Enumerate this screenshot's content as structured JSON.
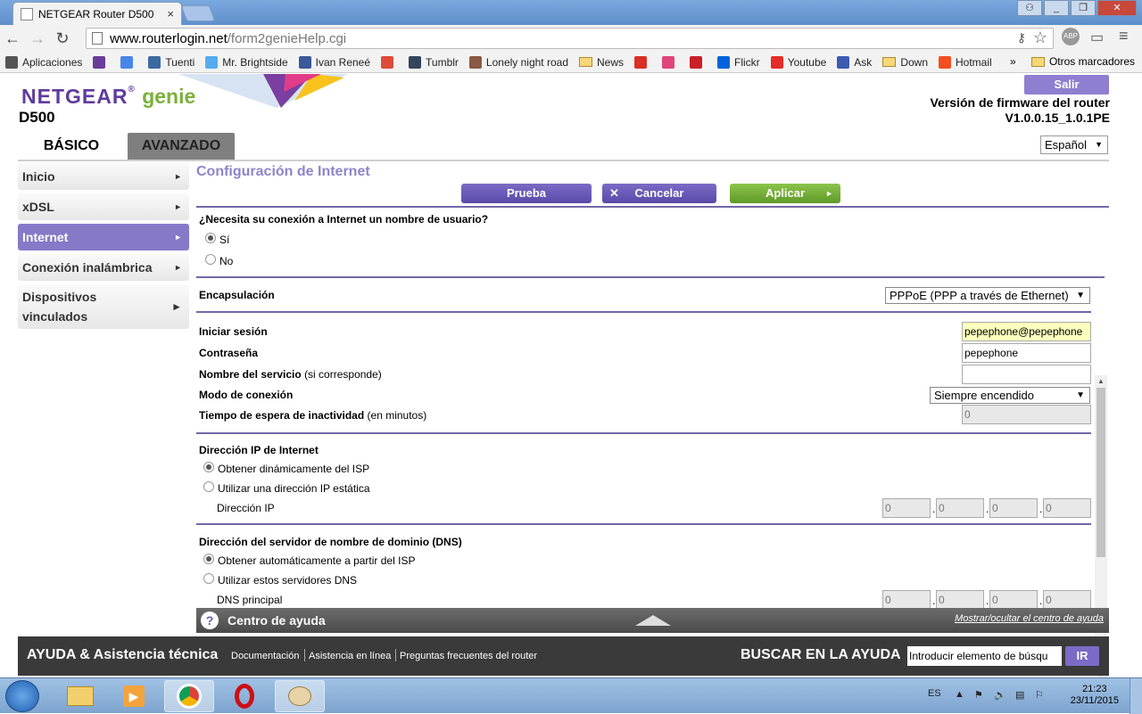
{
  "browser": {
    "tab_title": "NETGEAR Router D500",
    "tab_close": "×",
    "url_domain": "www.routerlogin.net",
    "url_path": "/form2genieHelp.cgi",
    "ext_label": "ABP",
    "bookmarks": [
      {
        "label": "Aplicaciones",
        "icon": "apps-grid-icon",
        "color": "#555555"
      },
      {
        "label": "",
        "icon": "grid-app-icon",
        "color": "#6a3d9a"
      },
      {
        "label": "",
        "icon": "google-icon",
        "color": "#4a86e8"
      },
      {
        "label": "Tuenti",
        "icon": "tuenti-icon",
        "color": "#3b6aa0"
      },
      {
        "label": "Mr. Brightside",
        "icon": "twitter-icon",
        "color": "#55acee"
      },
      {
        "label": "Ivan Reneé",
        "icon": "facebook-icon",
        "color": "#3b5998"
      },
      {
        "label": "",
        "icon": "gplus-icon",
        "color": "#dd4b39"
      },
      {
        "label": "Tumblr",
        "icon": "tumblr-icon",
        "color": "#35465c"
      },
      {
        "label": "Lonely night road",
        "icon": "image-icon",
        "color": "#8a5a44"
      },
      {
        "label": "News",
        "icon": "folder-icon",
        "color": "#f5d77a"
      },
      {
        "label": "",
        "icon": "upload-icon",
        "color": "#d93025"
      },
      {
        "label": "",
        "icon": "heart-icon",
        "color": "#e0457b"
      },
      {
        "label": "",
        "icon": "pinterest-icon",
        "color": "#cb2027"
      },
      {
        "label": "Flickr",
        "icon": "flickr-icon",
        "color": "#0063dc"
      },
      {
        "label": "Youtube",
        "icon": "youtube-icon",
        "color": "#e52d27"
      },
      {
        "label": "Ask",
        "icon": "ask-icon",
        "color": "#3b5bb0"
      },
      {
        "label": "Down",
        "icon": "folder-icon",
        "color": "#f5d77a"
      },
      {
        "label": "Hotmail",
        "icon": "hotmail-icon",
        "color": "#f25022"
      }
    ],
    "bm_more": "»",
    "bm_other": "Otros marcadores"
  },
  "header": {
    "brand_netgear": "NETGEAR",
    "brand_genie": "genie",
    "model": "D500",
    "logout": "Salir",
    "fw_label": "Versión de firmware del router",
    "fw_value": "V1.0.0.15_1.0.1PE",
    "language": "Español",
    "tab_basic": "BÁSICO",
    "tab_advanced": "AVANZADO"
  },
  "nav": {
    "items": [
      {
        "label": "Inicio"
      },
      {
        "label": "xDSL"
      },
      {
        "label": "Internet"
      },
      {
        "label": "Conexión inalámbrica"
      },
      {
        "label": "Dispositivos vinculados"
      }
    ],
    "arrow": "►"
  },
  "form": {
    "title": "Configuración de Internet",
    "btn_test": "Prueba",
    "btn_cancel": "Cancelar",
    "btn_cancel_icon": "✕",
    "btn_apply": "Aplicar",
    "q_username": "¿Necesita su conexión a Internet un nombre de usuario?",
    "opt_yes": "Sí",
    "opt_no": "No",
    "encap_label": "Encapsulación",
    "encap_value": "PPPoE (PPP a través de Ethernet)",
    "login_label": "Iniciar sesión",
    "login_value": "pepephone@pepephone",
    "pass_label": "Contraseña",
    "pass_value": "pepephone",
    "service_label": "Nombre del servicio",
    "service_note": "(si corresponde)",
    "service_value": "",
    "mode_label": "Modo de conexión",
    "mode_value": "Siempre encendido",
    "idle_label": "Tiempo de espera de inactividad",
    "idle_note": "(en minutos)",
    "idle_value": "0",
    "ip_title": "Dirección IP de Internet",
    "ip_opt_dynamic": "Obtener dinámicamente del ISP",
    "ip_opt_static": "Utilizar una dirección IP estática",
    "ip_label": "Dirección IP",
    "ip_octets": [
      "0",
      "0",
      "0",
      "0"
    ],
    "dns_title": "Dirección del servidor de nombre de dominio (DNS)",
    "dns_opt_auto": "Obtener automáticamente a partir del ISP",
    "dns_opt_manual": "Utilizar estos servidores DNS",
    "dns_primary_label": "DNS principal",
    "dns_octets": [
      "0",
      "0",
      "0",
      "0"
    ],
    "dot": "."
  },
  "help": {
    "icon": "?",
    "title": "Centro de ayuda",
    "toggle": "Mostrar/ocultar el centro de ayuda"
  },
  "footer": {
    "title": "AYUDA & Asistencia técnica",
    "link_docs": "Documentación",
    "link_online": "Asistencia en línea",
    "link_faq": "Preguntas frecuentes del router",
    "search_title": "BUSCAR EN LA AYUDA",
    "search_placeholder": "Introducir elemento de búsqu",
    "go": "IR"
  },
  "taskbar": {
    "lang": "ES",
    "time": "21:23",
    "date": "23/11/2015"
  },
  "colors": {
    "accent_purple": "#7b6bc6",
    "apply_green": "#6fae34",
    "nav_active": "#8679c8"
  }
}
